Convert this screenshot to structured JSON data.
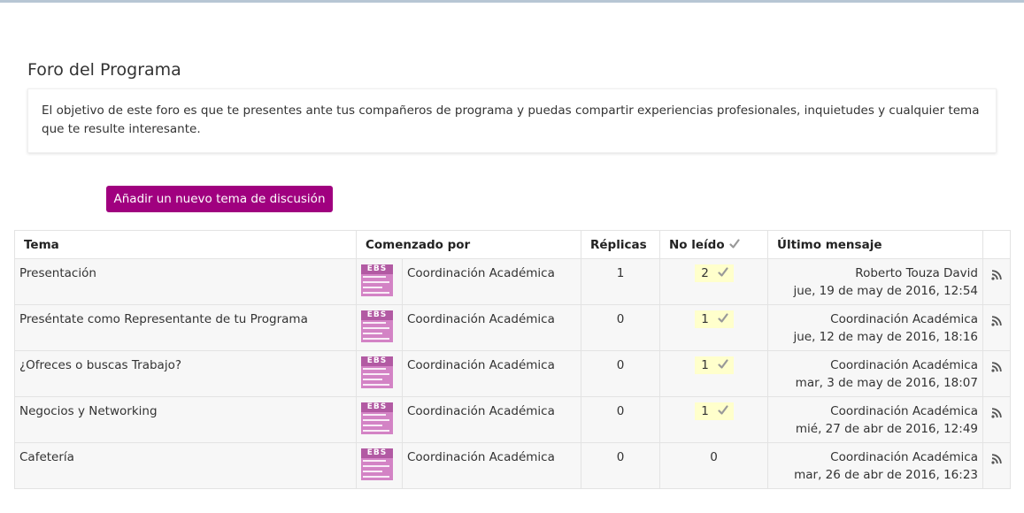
{
  "forum": {
    "title": "Foro del Programa",
    "intro": "El objetivo de este foro es que te presentes ante tus compañeros de programa y puedas compartir experiencias profesionales, inquietudes y cualquier tema que te resulte interesante.",
    "add_button": "Añadir un nuevo tema de discusión"
  },
  "table": {
    "headers": {
      "topic": "Tema",
      "started_by": "Comenzado por",
      "replies": "Réplicas",
      "unread": "No leído",
      "last_post": "Último mensaje"
    },
    "rows": [
      {
        "topic": "Presentación",
        "author": "Coordinación Académica",
        "replies": "1",
        "unread": "2",
        "last_author": "Roberto Touza David",
        "last_date": "jue, 19 de may de 2016, 12:54"
      },
      {
        "topic": "Preséntate como Representante de tu Programa",
        "author": "Coordinación Académica",
        "replies": "0",
        "unread": "1",
        "last_author": "Coordinación Académica",
        "last_date": "jue, 12 de may de 2016, 18:16"
      },
      {
        "topic": "¿Ofreces o buscas Trabajo?",
        "author": "Coordinación Académica",
        "replies": "0",
        "unread": "1",
        "last_author": "Coordinación Académica",
        "last_date": "mar, 3 de may de 2016, 18:07"
      },
      {
        "topic": "Negocios y Networking",
        "author": "Coordinación Académica",
        "replies": "0",
        "unread": "1",
        "last_author": "Coordinación Académica",
        "last_date": "mié, 27 de abr de 2016, 12:49"
      },
      {
        "topic": "Cafetería",
        "author": "Coordinación Académica",
        "replies": "0",
        "unread": "0",
        "last_author": "Coordinación Académica",
        "last_date": "mar, 26 de abr de 2016, 16:23"
      }
    ]
  },
  "avatar_logo": "EBS",
  "colors": {
    "button": "#a0007f",
    "unread_highlight": "#ffffcc",
    "avatar": "#d383c5"
  },
  "icons": {
    "check": "check-icon",
    "rss": "rss-icon"
  }
}
